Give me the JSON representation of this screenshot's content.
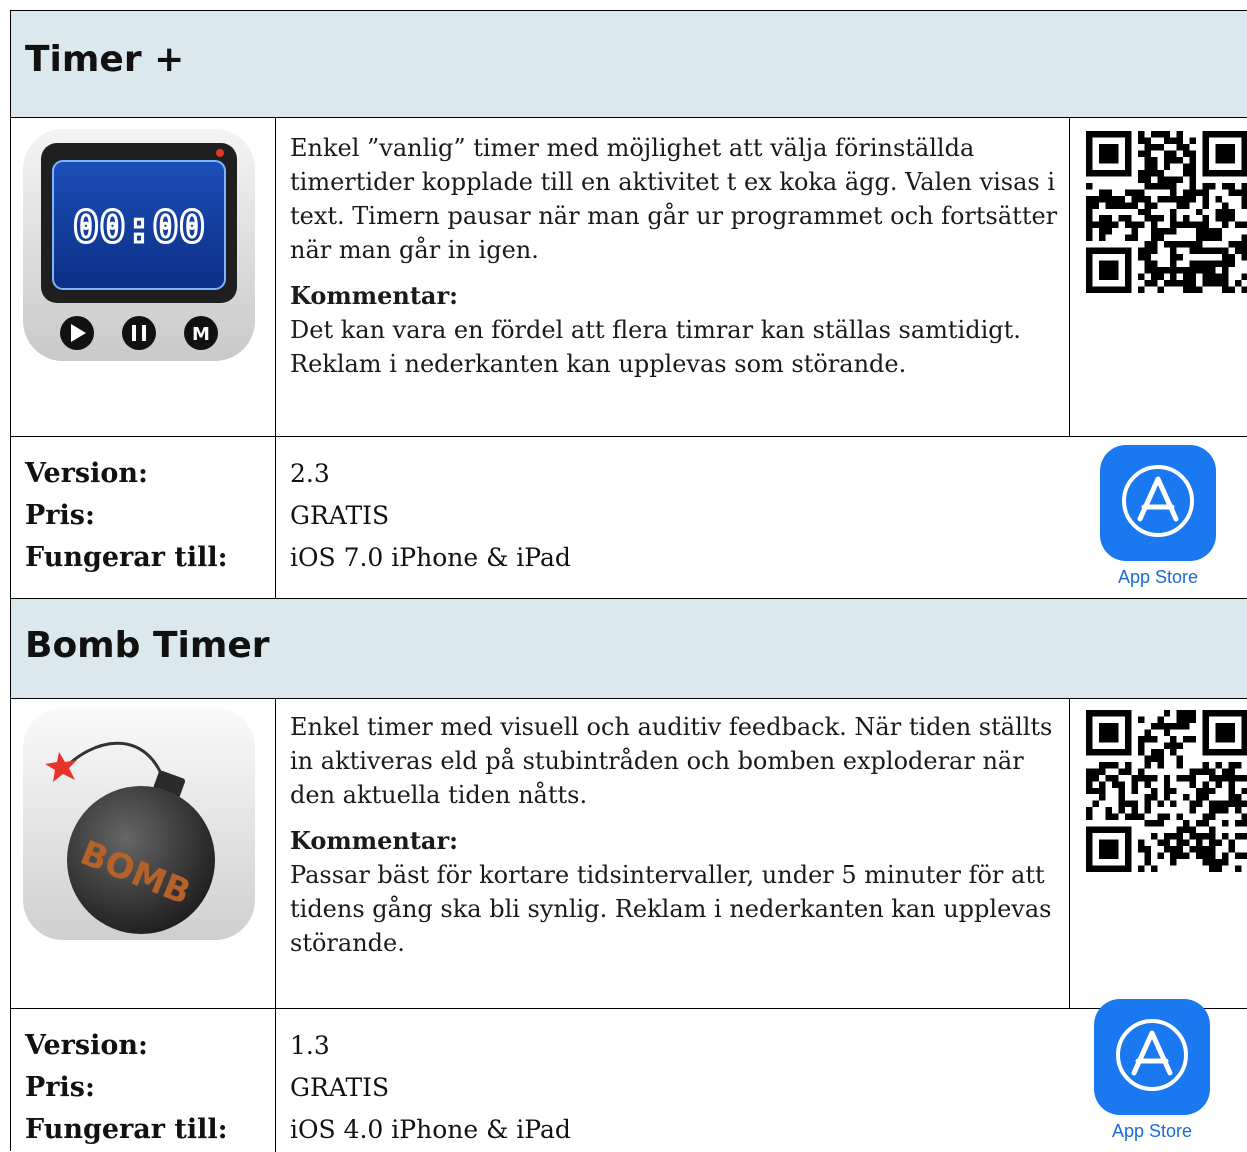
{
  "entries": [
    {
      "title": "Timer +",
      "description": "Enkel ”vanlig” timer med möjlighet att välja förinställda timertider kopplade till en aktivitet t ex koka ägg. Valen visas i text. Timern pausar när man går ur programmet och fortsätter när man går in igen.",
      "comment_label": "Kommentar:",
      "comment": "Det kan vara en fördel att flera timrar kan ställas samtidigt. Reklam i nederkanten kan upplevas som störande.",
      "labels": {
        "version": "Version:",
        "price": "Pris:",
        "works_with": "Fungerar till:"
      },
      "values": {
        "version": "2.3",
        "price": "GRATIS",
        "works_with": "iOS 7.0 iPhone & iPad"
      },
      "store_label": "App Store",
      "icon_display": "00:00",
      "icon_buttons": [
        "M"
      ]
    },
    {
      "title": "Bomb Timer",
      "description": "Enkel timer med visuell och auditiv feedback. När tiden ställts in aktiveras eld på stubintråden och bomben exploderar när den aktuella tiden nåtts.",
      "comment_label": "Kommentar:",
      "comment": "Passar bäst för kortare tidsintervaller, under 5 minuter för att tidens gång ska bli synlig. Reklam i nederkanten kan upplevas störande.",
      "labels": {
        "version": "Version:",
        "price": "Pris:",
        "works_with": "Fungerar till:"
      },
      "values": {
        "version": "1.3",
        "price": "GRATIS",
        "works_with": "iOS 4.0 iPhone & iPad"
      },
      "store_label": "App Store",
      "icon_text": "BOMB"
    }
  ],
  "colors": {
    "header_bg": "#dbe8ee",
    "store_blue": "#1a78f0",
    "store_text": "#1a6bd8"
  }
}
